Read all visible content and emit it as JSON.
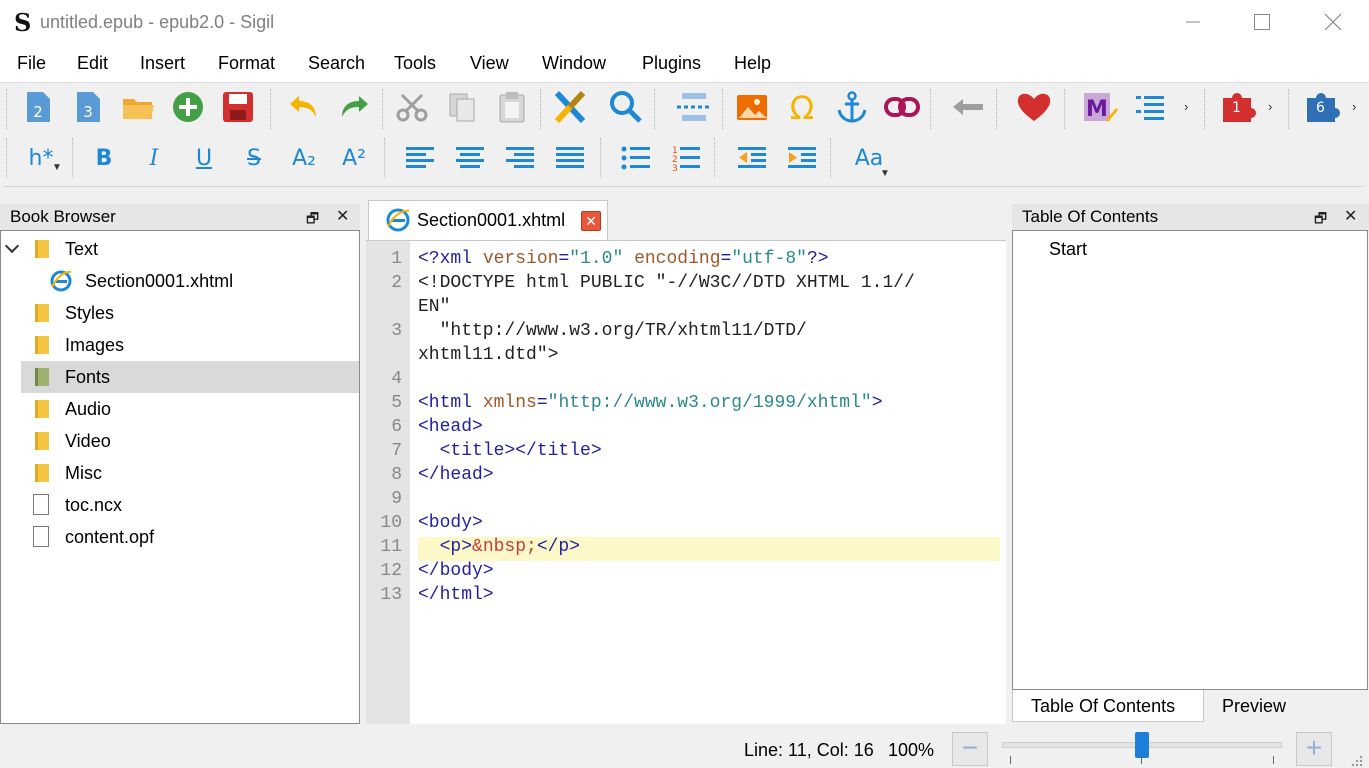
{
  "window": {
    "app_logo": "S",
    "title": "untitled.epub - epub2.0 - Sigil"
  },
  "menu": [
    "File",
    "Edit",
    "Insert",
    "Format",
    "Search",
    "Tools",
    "View",
    "Window",
    "Plugins",
    "Help"
  ],
  "toolbar2": {
    "heading": "h*",
    "bold": "B",
    "italic": "I",
    "underline": "U",
    "strike": "S",
    "subscript": "A₂",
    "superscript": "A²",
    "case": "Aa"
  },
  "book_browser": {
    "title": "Book Browser",
    "items": [
      {
        "label": "Text",
        "type": "folder"
      },
      {
        "label": "Section0001.xhtml",
        "type": "xhtml"
      },
      {
        "label": "Styles",
        "type": "folder"
      },
      {
        "label": "Images",
        "type": "folder"
      },
      {
        "label": "Fonts",
        "type": "folder",
        "selected": true
      },
      {
        "label": "Audio",
        "type": "folder"
      },
      {
        "label": "Video",
        "type": "folder"
      },
      {
        "label": "Misc",
        "type": "folder"
      },
      {
        "label": "toc.ncx",
        "type": "file"
      },
      {
        "label": "content.opf",
        "type": "file"
      }
    ]
  },
  "editor": {
    "tab_label": "Section0001.xhtml",
    "line_numbers": [
      "1",
      "2",
      "3",
      "4",
      "5",
      "6",
      "7",
      "8",
      "9",
      "10",
      "11",
      "12",
      "13"
    ],
    "current_line": 11
  },
  "toc": {
    "title": "Table Of Contents",
    "entries": [
      "Start"
    ],
    "tabs": [
      "Table Of Contents",
      "Preview"
    ]
  },
  "status": {
    "position": "Line: 11, Col: 16",
    "zoom": "100%",
    "zoom_fraction": 0.5
  },
  "toolbar_badges": {
    "plugin_red": "1",
    "plugin_blue": "6"
  }
}
